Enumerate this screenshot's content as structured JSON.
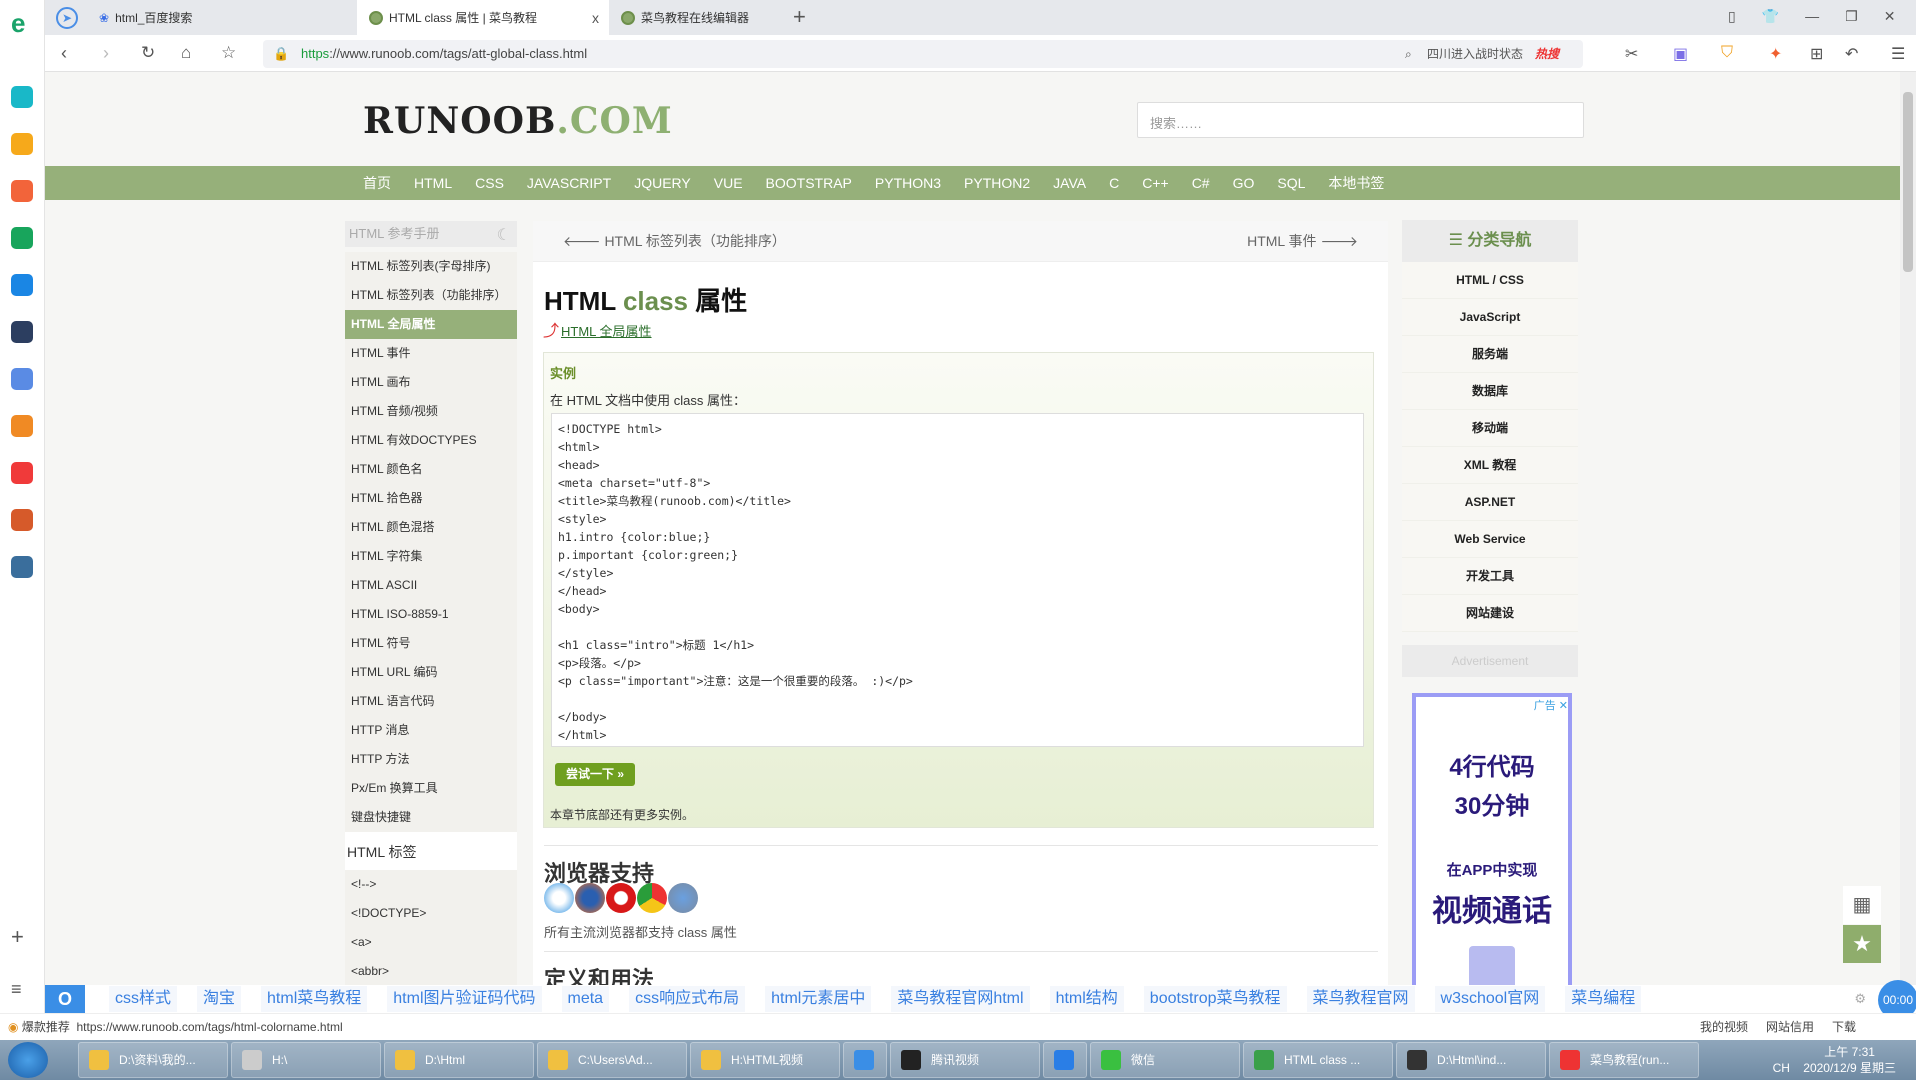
{
  "browser": {
    "tabs": [
      {
        "label": "html_百度搜索"
      },
      {
        "label": "HTML class 属性 | 菜鸟教程",
        "active": true,
        "close": "x"
      },
      {
        "label": "菜鸟教程在线编辑器"
      }
    ],
    "new_tab": "+",
    "url_scheme": "https",
    "url_rest": "://www.runoob.com/tags/att-global-class.html",
    "hot_search": "四川进入战时状态",
    "hot_badge": "热搜"
  },
  "site": {
    "logo_main": "RUNOOB",
    "logo_ext": ".COM",
    "search_placeholder": "搜索……",
    "nav": [
      "首页",
      "HTML",
      "CSS",
      "JAVASCRIPT",
      "JQUERY",
      "VUE",
      "BOOTSTRAP",
      "PYTHON3",
      "PYTHON2",
      "JAVA",
      "C",
      "C++",
      "C#",
      "GO",
      "SQL",
      "本地书签"
    ],
    "accent": "#96b07a"
  },
  "sidebar": {
    "title": "HTML 参考手册",
    "items": [
      "HTML 标签列表(字母排序)",
      "HTML 标签列表（功能排序）",
      "HTML 全局属性",
      "HTML 事件",
      "HTML 画布",
      "HTML 音频/视频",
      "HTML 有效DOCTYPES",
      "HTML 颜色名",
      "HTML 拾色器",
      "HTML 颜色混搭",
      "HTML 字符集",
      "HTML ASCII",
      "HTML ISO-8859-1",
      "HTML 符号",
      "HTML URL 编码",
      "HTML 语言代码",
      "HTTP 消息",
      "HTTP 方法",
      "Px/Em 换算工具",
      "键盘快捷键"
    ],
    "active_index": 2,
    "section2": "HTML 标签",
    "tags": [
      "<!-->",
      "<!DOCTYPE>",
      "<a>",
      "<abbr>"
    ]
  },
  "main": {
    "prev": "HTML 标签列表（功能排序）",
    "next": "HTML 事件",
    "title_a": "HTML ",
    "title_b": "class",
    "title_c": " 属性",
    "back_link": "HTML 全局属性",
    "example_label": "实例",
    "example_desc": "在 HTML 文档中使用 class 属性：",
    "code": "<!DOCTYPE html>\n<html>\n<head>\n<meta charset=\"utf-8\">\n<title>菜鸟教程(runoob.com)</title>\n<style>\nh1.intro {color:blue;}\np.important {color:green;}\n</style>\n</head>\n<body>\n\n<h1 class=\"intro\">标题 1</h1>\n<p>段落。</p>\n<p class=\"important\">注意：这是一个很重要的段落。 :)</p>\n\n</body>\n</html>",
    "try_button": "尝试一下 »",
    "more": "本章节底部还有更多实例。",
    "browser_support": "浏览器支持",
    "support_note": "所有主流浏览器都支持 class 属性",
    "definition": "定义和用法"
  },
  "right_nav": {
    "title": "分类导航",
    "items": [
      "HTML / CSS",
      "JavaScript",
      "服务端",
      "数据库",
      "移动端",
      "XML 教程",
      "ASP.NET",
      "Web Service",
      "开发工具",
      "网站建设"
    ]
  },
  "ad": {
    "header": "Advertisement",
    "badge": "广告",
    "line1": "4行代码",
    "line2": "30分钟",
    "line3": "在APP中实现",
    "line4": "视频通话"
  },
  "hotbar": {
    "items": [
      "css样式",
      "淘宝",
      "html菜鸟教程",
      "html图片验证码代码",
      "meta",
      "css响应式布局",
      "html元素居中",
      "菜鸟教程官网html",
      "html结构",
      "bootstrop菜鸟教程",
      "菜鸟教程官网",
      "w3school官网",
      "菜鸟编程"
    ],
    "timer": "00:00"
  },
  "status": {
    "badge": "爆款推荐",
    "link": "https://www.runoob.com/tags/html-colorname.html",
    "right": [
      "我的视频",
      "网站信用",
      "下载"
    ]
  },
  "taskbar": {
    "items": [
      "D:\\资料\\我的...",
      "H:\\",
      "D:\\Html",
      "C:\\Users\\Ad...",
      "H:\\HTML视频",
      "",
      "腾讯视频",
      "",
      "微信",
      "HTML class ...",
      "D:\\Html\\ind...",
      "菜鸟教程(run..."
    ],
    "lang": "CH",
    "time": "上午 7:31",
    "date": "2020/12/9 星期三"
  }
}
